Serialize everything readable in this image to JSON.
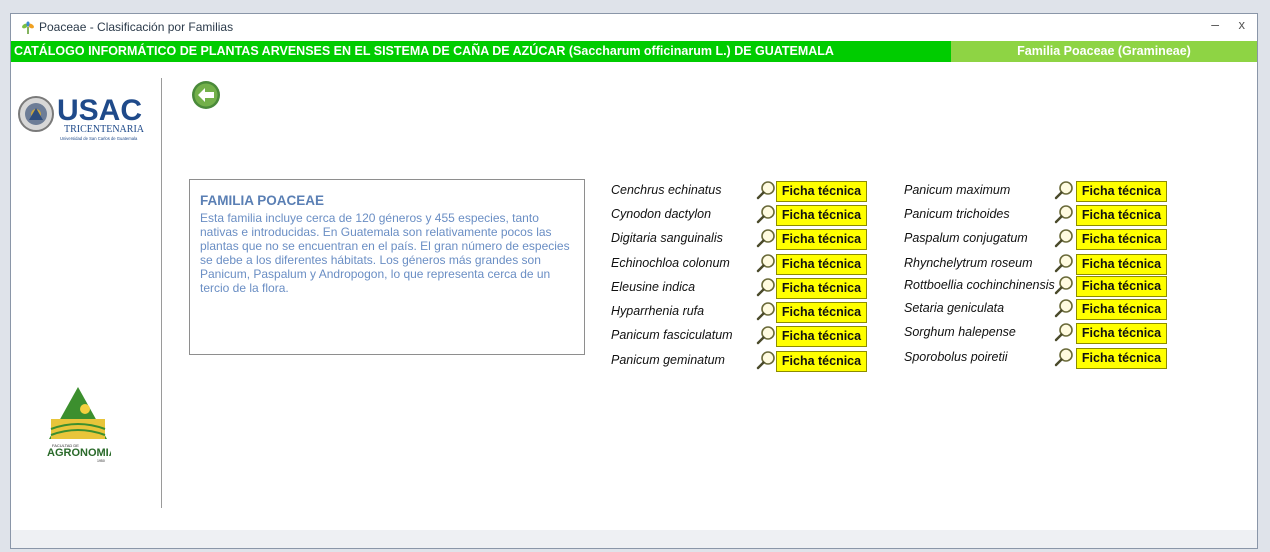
{
  "window": {
    "title": "Poaceae - Clasificación por Familias",
    "minimize": "–",
    "close": "x"
  },
  "header": {
    "catalog_title": "CATÁLOGO INFORMÁTICO DE PLANTAS ARVENSES EN EL SISTEMA DE CAÑA DE AZÚCAR (Saccharum officinarum L.) DE GUATEMALA",
    "family_title": "Familia Poaceae (Gramineae)"
  },
  "logos": {
    "usac_main": "USAC",
    "usac_sub": "TRICENTENARIA",
    "usac_caption": "Universidad de San Carlos de Guatemala",
    "agro_top": "FACULTAD DE",
    "agro_name": "AGRONOMIA",
    "agro_year": "1950"
  },
  "info": {
    "heading": "FAMILIA POACEAE",
    "body": "Esta familia incluye cerca de 120 géneros y 455 especies, tanto nativas e introducidas. En Guatemala son relativamente pocos las plantas que no se encuentran en el país. El gran número de especies se debe a los diferentes hábitats. Los géneros más grandes son Panicum, Paspalum y Andropogon, lo que representa cerca de un tercio de la flora."
  },
  "species_left": [
    {
      "name": "Cenchrus echinatus",
      "button": "Ficha técnica"
    },
    {
      "name": "Cynodon dactylon",
      "button": "Ficha técnica"
    },
    {
      "name": "Digitaria sanguinalis",
      "button": "Ficha técnica"
    },
    {
      "name": "Echinochloa colonum",
      "button": "Ficha técnica"
    },
    {
      "name": "Eleusine indica",
      "button": "Ficha técnica"
    },
    {
      "name": "Hyparrhenia rufa",
      "button": "Ficha técnica"
    },
    {
      "name": "Panicum fasciculatum",
      "button": "Ficha técnica"
    },
    {
      "name": "Panicum geminatum",
      "button": "Ficha técnica"
    }
  ],
  "species_right": [
    {
      "name": "Panicum maximum",
      "button": "Ficha técnica"
    },
    {
      "name": "Panicum trichoides",
      "button": "Ficha técnica"
    },
    {
      "name": "Paspalum conjugatum",
      "button": "Ficha técnica"
    },
    {
      "name": "Rhynchelytrum roseum",
      "button": "Ficha técnica"
    },
    {
      "name": "Rottboellia cochinchinensis",
      "button": "Ficha técnica"
    },
    {
      "name": "Setaria geniculata",
      "button": "Ficha técnica"
    },
    {
      "name": "Sorghum halepense",
      "button": "Ficha técnica"
    },
    {
      "name": "Sporobolus poiretii",
      "button": "Ficha técnica"
    }
  ],
  "colors": {
    "header_green": "#00cc00",
    "header_light_green": "#8ed444",
    "button_yellow": "#ffff00",
    "info_text": "#6a8ec4"
  }
}
